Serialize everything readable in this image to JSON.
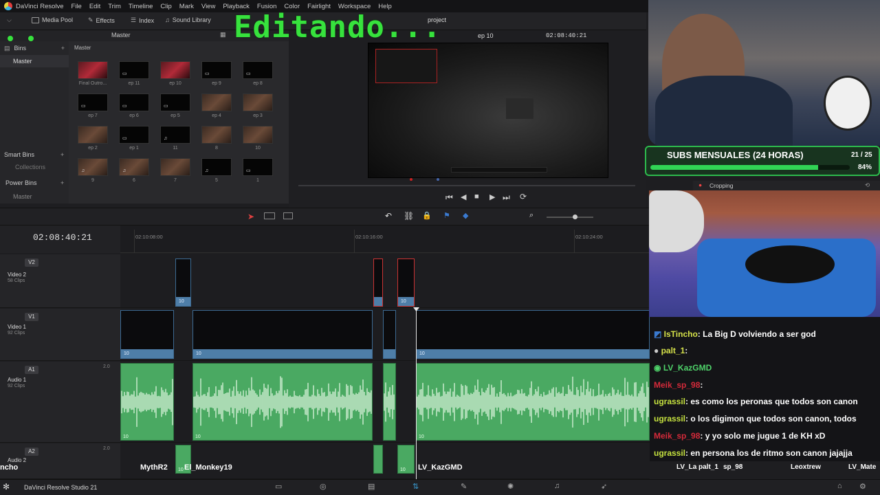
{
  "app": {
    "name": "DaVinci Resolve",
    "menu": [
      "File",
      "Edit",
      "Trim",
      "Timeline",
      "Clip",
      "Mark",
      "View",
      "Playback",
      "Fusion",
      "Color",
      "Fairlight",
      "Workspace",
      "Help"
    ],
    "project_title": "project"
  },
  "overlay": {
    "title": "Editando..."
  },
  "toolbar": {
    "media_pool": "Media Pool",
    "effects": "Effects",
    "index": "Index",
    "sound_library": "Sound Library",
    "timeline_name": "ep 10",
    "viewer_timecode": "02:08:40:21"
  },
  "bins": {
    "header": "Bins",
    "master": "Master",
    "smart_bins": "Smart Bins",
    "collections": "Collections",
    "power_bins": "Power Bins",
    "power_master": "Master"
  },
  "pool": {
    "header": "Master",
    "breadcrumb": "Master",
    "clips": [
      "Final Outro...",
      "ep 11",
      "ep 10",
      "ep 9",
      "ep 8",
      "ep 7",
      "ep 6",
      "ep 5",
      "ep 4",
      "ep 3",
      "ep 2",
      "ep 1",
      "11",
      "8",
      "10",
      "9",
      "6",
      "7",
      "5",
      "1"
    ]
  },
  "timeline": {
    "timecode": "02:08:40:21",
    "ruler_marks": [
      "02:10:08:00",
      "02:10:16:00",
      "02:10:24:00"
    ],
    "tracks": {
      "v2": {
        "badge": "V2",
        "name": "Video 2",
        "sub": "58 Clips"
      },
      "v1": {
        "badge": "V1",
        "name": "Video 1",
        "sub": "92 Clips"
      },
      "a1": {
        "badge": "A1",
        "name": "Audio 1",
        "sub": "92 Clips",
        "level": "2.0"
      },
      "a2": {
        "badge": "A2",
        "name": "Audio 2",
        "level": "2.0"
      }
    },
    "clip_label": "10"
  },
  "stream": {
    "subs_title": "SUBS MENSUALES (24 HORAS)",
    "subs_count": "21 / 25",
    "subs_percent": "84%",
    "subs_progress": 0.84,
    "cropping_label": "Cropping"
  },
  "chat": [
    {
      "user": "IsTincho",
      "msg": ": La Big D volviendo a ser god",
      "color": "#d6e24a"
    },
    {
      "user": "palt_1",
      "msg": ":",
      "color": "#d6e24a"
    },
    {
      "user": "LV_KazGMD",
      "msg": "",
      "color": "#4fd36a"
    },
    {
      "user": "Meik_sp_98",
      "msg": ":",
      "color": "#d52a3a"
    },
    {
      "user": "ugrassil",
      "msg": ": es como los peronas que todos son canon",
      "color": "#c6e23f"
    },
    {
      "user": "ugrassil",
      "msg": ": o los digimon que todos son canon, todos",
      "color": "#c6e23f"
    },
    {
      "user": "Meik_sp_98",
      "msg": ": y yo solo me jugue 1 de KH xD",
      "color": "#d52a3a"
    },
    {
      "user": "ugrassil",
      "msg": ": en persona los de ritmo son canon jajajja",
      "color": "#c6e23f"
    }
  ],
  "viewers": [
    "ncho",
    "MythR2",
    "El_Monkey19",
    "LV_KazGMD",
    "LV_La",
    "palt_1",
    "sp_98",
    "Leoxtrew",
    "LV_Mate"
  ],
  "taskbar": {
    "app_label": "DaVinci Resolve Studio 21"
  }
}
